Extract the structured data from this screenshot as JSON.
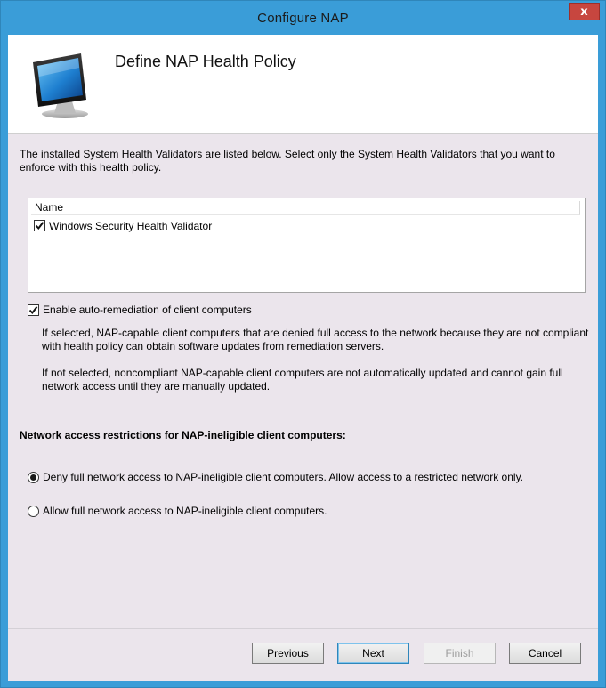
{
  "window": {
    "title": "Configure NAP",
    "close_glyph": "x"
  },
  "header": {
    "title": "Define NAP Health Policy",
    "icon": "computer-monitor-icon"
  },
  "intro_text": "The installed System Health Validators are listed below. Select only the System Health Validators that you want to enforce with this health policy.",
  "validators": {
    "column_header": "Name",
    "items": [
      {
        "label": "Windows Security Health Validator",
        "checked": true
      }
    ]
  },
  "auto_remediation": {
    "label": "Enable auto-remediation of client computers",
    "checked": true,
    "description_selected": "If selected, NAP-capable client computers that are denied full access to the network because they are not compliant with health policy can obtain software updates from remediation servers.",
    "description_not_selected": "If not selected, noncompliant NAP-capable client computers are not automatically updated and cannot gain full network access until they are manually updated."
  },
  "restrictions": {
    "heading": "Network access restrictions for NAP-ineligible client computers:",
    "options": [
      {
        "label": "Deny full network access to NAP-ineligible client computers. Allow access to a restricted network only.",
        "selected": true
      },
      {
        "label": "Allow full network access to NAP-ineligible client computers.",
        "selected": false
      }
    ]
  },
  "buttons": {
    "previous": "Previous",
    "next": "Next",
    "finish": "Finish",
    "cancel": "Cancel",
    "finish_enabled": false
  },
  "colors": {
    "titlebar": "#3a9dd8",
    "close_button": "#c7463f",
    "dialog_background": "#ebe5ec"
  }
}
